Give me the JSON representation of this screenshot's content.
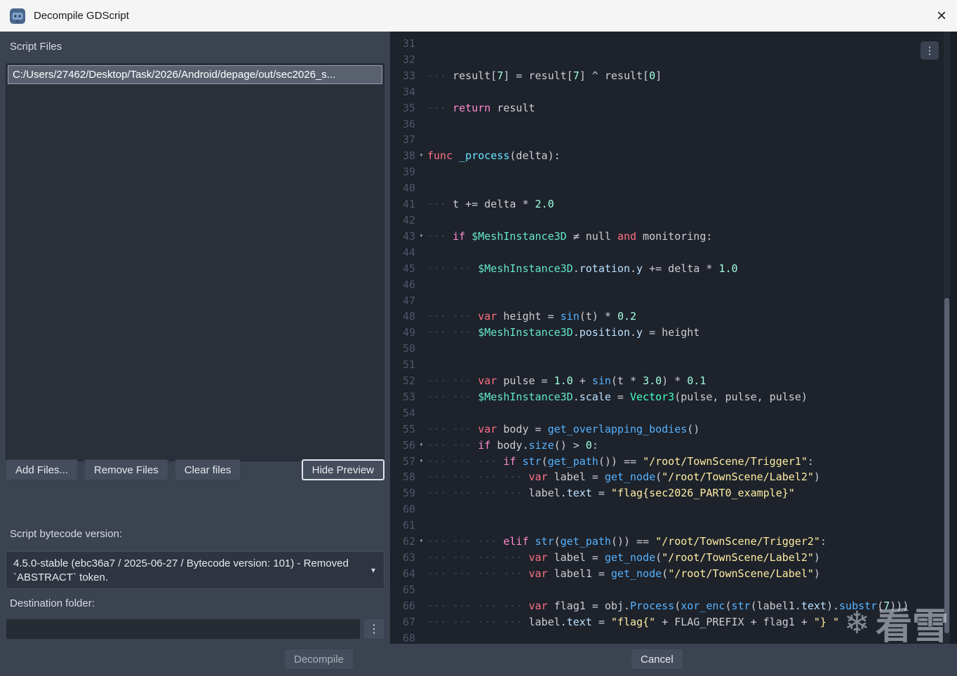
{
  "window": {
    "title": "Decompile GDScript",
    "close_glyph": "×"
  },
  "left_panel": {
    "script_files_label": "Script Files",
    "files": [
      "C:/Users/27462/Desktop/Task/2026/Android/depage/out/sec2026_s..."
    ],
    "buttons": {
      "add": "Add Files...",
      "remove": "Remove Files",
      "clear": "Clear files",
      "hide_preview": "Hide Preview"
    },
    "bytecode_label": "Script bytecode version:",
    "bytecode_value": "4.5.0-stable (ebc36a7 / 2025-06-27 / Bytecode version: 101) - Removed `ABSTRACT` token.",
    "dropdown_chevron_glyph": "▾",
    "destination_label": "Destination folder:",
    "destination_value": "",
    "kebab_glyph": "⋮"
  },
  "footer": {
    "decompile_label": "Decompile",
    "cancel_label": "Cancel"
  },
  "editor": {
    "menu_glyph": "⋮",
    "fold_glyph": "▾",
    "tab_glyph": "··· ",
    "lines": [
      {
        "n": 31,
        "t": []
      },
      {
        "n": 32,
        "t": []
      },
      {
        "n": 33,
        "ind": 1,
        "t": [
          [
            "result[",
            "d"
          ],
          [
            "7",
            "n"
          ],
          [
            "] = result[",
            "d"
          ],
          [
            "7",
            "n"
          ],
          [
            "] ^ result[",
            "d"
          ],
          [
            "0",
            "n"
          ],
          [
            "]",
            "d"
          ]
        ]
      },
      {
        "n": 34,
        "t": []
      },
      {
        "n": 35,
        "ind": 1,
        "t": [
          [
            "return",
            "c"
          ],
          [
            " result",
            "d"
          ]
        ]
      },
      {
        "n": 36,
        "t": []
      },
      {
        "n": 37,
        "t": []
      },
      {
        "n": 38,
        "fold": true,
        "t": [
          [
            "func",
            "k"
          ],
          [
            " ",
            "d"
          ],
          [
            "_process",
            "fd"
          ],
          [
            "(delta):",
            "d"
          ]
        ]
      },
      {
        "n": 39,
        "t": []
      },
      {
        "n": 40,
        "t": []
      },
      {
        "n": 41,
        "ind": 1,
        "t": [
          [
            "t += delta * ",
            "d"
          ],
          [
            "2.0",
            "n"
          ]
        ]
      },
      {
        "n": 42,
        "t": []
      },
      {
        "n": 43,
        "ind": 1,
        "fold": true,
        "t": [
          [
            "if",
            "c"
          ],
          [
            " ",
            "d"
          ],
          [
            "$MeshInstance3D",
            "np"
          ],
          [
            " ≠ null ",
            "d"
          ],
          [
            "and",
            "k"
          ],
          [
            " monitoring:",
            "d"
          ]
        ]
      },
      {
        "n": 44,
        "t": []
      },
      {
        "n": 45,
        "ind": 2,
        "t": [
          [
            "$MeshInstance3D",
            "np"
          ],
          [
            ".",
            "d"
          ],
          [
            "rotation",
            "m"
          ],
          [
            ".",
            "d"
          ],
          [
            "y",
            "m"
          ],
          [
            " += delta * ",
            "d"
          ],
          [
            "1.0",
            "n"
          ]
        ]
      },
      {
        "n": 46,
        "t": []
      },
      {
        "n": 47,
        "t": []
      },
      {
        "n": 48,
        "ind": 2,
        "t": [
          [
            "var",
            "k"
          ],
          [
            " height = ",
            "d"
          ],
          [
            "sin",
            "f"
          ],
          [
            "(t) * ",
            "d"
          ],
          [
            "0.2",
            "n"
          ]
        ]
      },
      {
        "n": 49,
        "ind": 2,
        "t": [
          [
            "$MeshInstance3D",
            "np"
          ],
          [
            ".",
            "d"
          ],
          [
            "position",
            "m"
          ],
          [
            ".",
            "d"
          ],
          [
            "y",
            "m"
          ],
          [
            " = height",
            "d"
          ]
        ]
      },
      {
        "n": 50,
        "t": []
      },
      {
        "n": 51,
        "t": []
      },
      {
        "n": 52,
        "ind": 2,
        "t": [
          [
            "var",
            "k"
          ],
          [
            " pulse = ",
            "d"
          ],
          [
            "1.0",
            "n"
          ],
          [
            " + ",
            "d"
          ],
          [
            "sin",
            "f"
          ],
          [
            "(t * ",
            "d"
          ],
          [
            "3.0",
            "n"
          ],
          [
            ") * ",
            "d"
          ],
          [
            "0.1",
            "n"
          ]
        ]
      },
      {
        "n": 53,
        "ind": 2,
        "t": [
          [
            "$MeshInstance3D",
            "np"
          ],
          [
            ".",
            "d"
          ],
          [
            "scale",
            "m"
          ],
          [
            " = ",
            "d"
          ],
          [
            "Vector3",
            "ty"
          ],
          [
            "(pulse, pulse, pulse)",
            "d"
          ]
        ]
      },
      {
        "n": 54,
        "t": []
      },
      {
        "n": 55,
        "ind": 2,
        "t": [
          [
            "var",
            "k"
          ],
          [
            " body = ",
            "d"
          ],
          [
            "get_overlapping_bodies",
            "f"
          ],
          [
            "()",
            "d"
          ]
        ]
      },
      {
        "n": 56,
        "ind": 2,
        "fold": true,
        "t": [
          [
            "if",
            "c"
          ],
          [
            " body.",
            "d"
          ],
          [
            "size",
            "f"
          ],
          [
            "() > ",
            "d"
          ],
          [
            "0",
            "n"
          ],
          [
            ":",
            "d"
          ]
        ]
      },
      {
        "n": 57,
        "ind": 3,
        "fold": true,
        "t": [
          [
            "if",
            "c"
          ],
          [
            " ",
            "d"
          ],
          [
            "str",
            "f"
          ],
          [
            "(",
            "d"
          ],
          [
            "get_path",
            "f"
          ],
          [
            "()) == ",
            "d"
          ],
          [
            "\"/root/TownScene/Trigger1\"",
            "s"
          ],
          [
            ":",
            "d"
          ]
        ]
      },
      {
        "n": 58,
        "ind": 4,
        "t": [
          [
            "var",
            "k"
          ],
          [
            " label = ",
            "d"
          ],
          [
            "get_node",
            "f"
          ],
          [
            "(",
            "d"
          ],
          [
            "\"/root/TownScene/Label2\"",
            "s"
          ],
          [
            ")",
            "d"
          ]
        ]
      },
      {
        "n": 59,
        "ind": 4,
        "t": [
          [
            "label.",
            "d"
          ],
          [
            "text",
            "m"
          ],
          [
            " = ",
            "d"
          ],
          [
            "\"flag{sec2026_PART0_example}\"",
            "s"
          ]
        ]
      },
      {
        "n": 60,
        "t": []
      },
      {
        "n": 61,
        "t": []
      },
      {
        "n": 62,
        "ind": 3,
        "fold": true,
        "t": [
          [
            "elif",
            "c"
          ],
          [
            " ",
            "d"
          ],
          [
            "str",
            "f"
          ],
          [
            "(",
            "d"
          ],
          [
            "get_path",
            "f"
          ],
          [
            "()) == ",
            "d"
          ],
          [
            "\"/root/TownScene/Trigger2\"",
            "s"
          ],
          [
            ":",
            "d"
          ]
        ]
      },
      {
        "n": 63,
        "ind": 4,
        "t": [
          [
            "var",
            "k"
          ],
          [
            " label = ",
            "d"
          ],
          [
            "get_node",
            "f"
          ],
          [
            "(",
            "d"
          ],
          [
            "\"/root/TownScene/Label2\"",
            "s"
          ],
          [
            ")",
            "d"
          ]
        ]
      },
      {
        "n": 64,
        "ind": 4,
        "t": [
          [
            "var",
            "k"
          ],
          [
            " label1 = ",
            "d"
          ],
          [
            "get_node",
            "f"
          ],
          [
            "(",
            "d"
          ],
          [
            "\"/root/TownScene/Label\"",
            "s"
          ],
          [
            ")",
            "d"
          ]
        ]
      },
      {
        "n": 65,
        "t": []
      },
      {
        "n": 66,
        "ind": 4,
        "t": [
          [
            "var",
            "k"
          ],
          [
            " flag1 = obj.",
            "d"
          ],
          [
            "Process",
            "f"
          ],
          [
            "(",
            "d"
          ],
          [
            "xor_enc",
            "f"
          ],
          [
            "(",
            "d"
          ],
          [
            "str",
            "f"
          ],
          [
            "(label1.",
            "d"
          ],
          [
            "text",
            "m"
          ],
          [
            ").",
            "d"
          ],
          [
            "substr",
            "f"
          ],
          [
            "(",
            "d"
          ],
          [
            "7",
            "n"
          ],
          [
            ")))",
            "d"
          ]
        ]
      },
      {
        "n": 67,
        "ind": 4,
        "t": [
          [
            "label.",
            "d"
          ],
          [
            "text",
            "m"
          ],
          [
            " = ",
            "d"
          ],
          [
            "\"flag{\"",
            "s"
          ],
          [
            " + FLAG_PREFIX + flag1 + ",
            "d"
          ],
          [
            "\"} \"",
            "s"
          ]
        ]
      },
      {
        "n": 68,
        "t": []
      }
    ]
  },
  "watermark": {
    "flake_glyph": "❄",
    "text": "看雪"
  },
  "colors": {
    "keyword": "#ff7085",
    "control_flow": "#ff8ccc",
    "function_call": "#57b3ff",
    "function_def": "#66e6ff",
    "number": "#a1ffe0",
    "string": "#ffeda1",
    "base_type": "#42ffc2",
    "node_path": "#64e8c4",
    "member": "#bce0ff",
    "code_bg": "#1d222b",
    "panel_bg": "#3b4250",
    "titlebar_bg": "#f5f5f5",
    "selection_bg": "#59616f"
  }
}
